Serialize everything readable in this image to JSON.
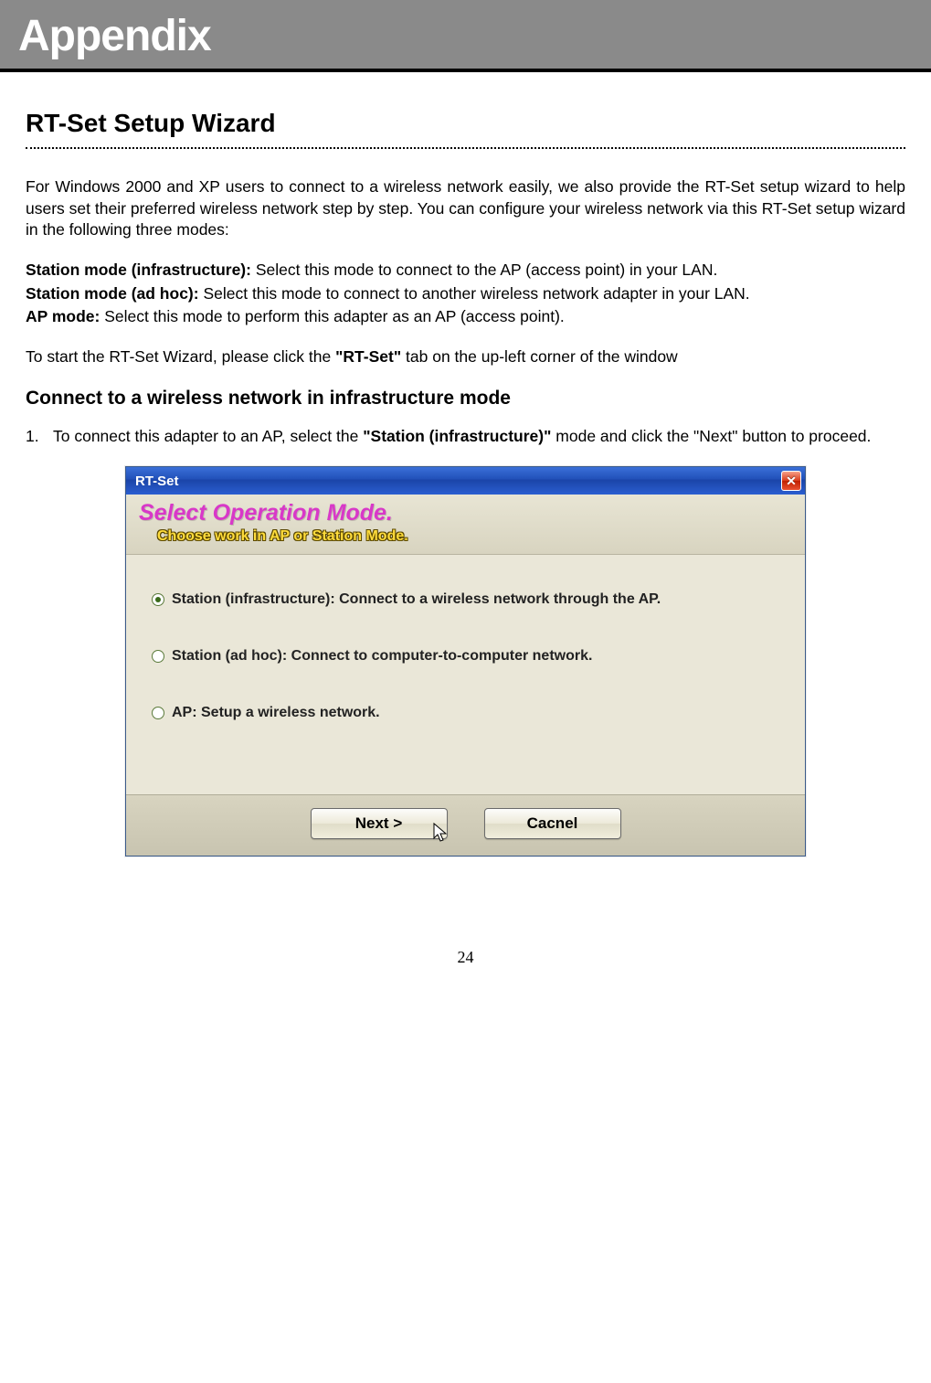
{
  "header": {
    "title": "Appendix"
  },
  "section": {
    "title": "RT-Set Setup Wizard"
  },
  "intro": "For Windows 2000 and XP users to connect to a wireless network easily, we also provide the RT-Set setup wizard to help users set their preferred wireless network step by step. You can configure your wireless network via this RT-Set setup wizard in the following three modes:",
  "modes": {
    "m1_label": "Station mode (infrastructure):",
    "m1_text": " Select this mode to connect to the AP (access point) in your LAN.",
    "m2_label": "Station mode (ad hoc):",
    "m2_text": " Select this mode to connect to another wireless network adapter in your LAN.",
    "m3_label": "AP mode:",
    "m3_text": " Select this mode to perform this adapter as an AP (access point)."
  },
  "start_pre": "To start the RT-Set Wizard, please click the ",
  "start_bold": "\"RT-Set\"",
  "start_post": " tab on the up-left corner of the window",
  "subheading": "Connect to a wireless network in infrastructure mode",
  "step1": {
    "num": "1.",
    "pre": "To connect this adapter to an AP, select the ",
    "bold": "\"Station (infrastructure)\"",
    "post": " mode and click the \"Next\" button to proceed."
  },
  "dialog": {
    "title": "RT-Set",
    "banner_title": "Select Operation Mode.",
    "banner_sub": "Choose work in AP or Station Mode.",
    "options": [
      {
        "selected": true,
        "text": "Station (infrastructure):   Connect to a wireless network through the AP."
      },
      {
        "selected": false,
        "text": "Station (ad hoc):   Connect to computer-to-computer network."
      },
      {
        "selected": false,
        "text": "AP:   Setup a wireless network."
      }
    ],
    "next_label": "Next >",
    "cancel_label": "Cacnel"
  },
  "page_number": "24"
}
